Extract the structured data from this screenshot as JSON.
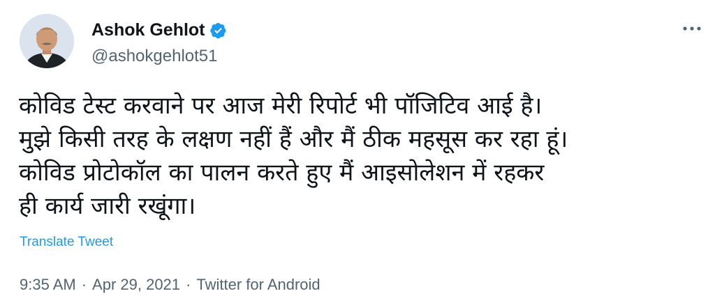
{
  "author": {
    "display_name": "Ashok Gehlot",
    "handle": "@ashokgehlot51",
    "verified_icon": "verified-badge-icon",
    "avatar_icon": "profile-photo"
  },
  "tweet": {
    "lines": [
      "कोविड टेस्ट करवाने पर आज मेरी रिपोर्ट भी पॉजिटिव आई है।",
      "मुझे किसी तरह के लक्षण नहीं हैं और मैं ठीक महसूस कर रहा हूं।",
      "कोविड प्रोटोकॉल का पालन करते हुए मैं आइसोलेशन में रहकर",
      "ही कार्य जारी रखूंगा।"
    ],
    "translate_label": "Translate Tweet"
  },
  "meta": {
    "time": "9:35 AM",
    "separator": "·",
    "date": "Apr 29, 2021",
    "source": "Twitter for Android"
  },
  "colors": {
    "accent": "#1d9bf0",
    "secondary_text": "#536471",
    "primary_text": "#0f1419"
  },
  "icons": {
    "more": "more-options-icon"
  }
}
